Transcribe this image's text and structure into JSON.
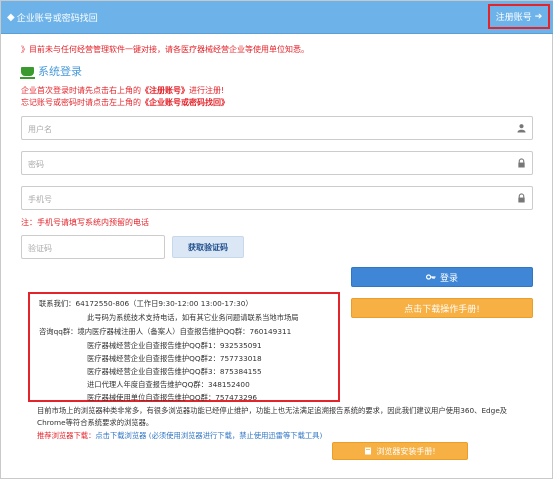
{
  "header": {
    "back_arrow": "◆",
    "back_label": "企业账号或密码找回",
    "register_label": "注册账号",
    "register_arrow": "➔"
  },
  "notice": "》目前未与任何经营管理软件一键对接，请各医疗器械经营企业等使用单位知悉。",
  "section_title": "系统登录",
  "hints": {
    "line1_prefix": "企业首次登录时请先点击右上角的",
    "line1_bold": "《注册账号》",
    "line1_suffix": "进行注册!",
    "line2_prefix": "忘记账号或密码时请点击左上角的",
    "line2_bold": "《企业账号或密码找回》"
  },
  "fields": {
    "username_placeholder": "用户名",
    "password_placeholder": "密码",
    "phone_placeholder": "手机号",
    "code_placeholder": "验证码"
  },
  "phone_note": "注：手机号请填写系统内预留的电话",
  "buttons": {
    "get_code": "获取验证码",
    "login": "登录",
    "manual": "点击下载操作手册!",
    "install": "浏览器安装手册!"
  },
  "contact": {
    "line1": "联系我们：64172550-806（工作日9:30-12:00 13:00-17:30）",
    "line2": "此号码为系统技术支持电话，如有其它业务问题请联系当地市场局",
    "line3": "咨询qq群：境内医疗器械注册人（备案人）自查报告维护QQ群：760149311",
    "line4": "医疗器械经营企业自查报告维护QQ群1：932535091",
    "line5": "医疗器械经营企业自查报告维护QQ群2：757733018",
    "line6": "医疗器械经营企业自查报告维护QQ群3：875384155",
    "line7": "进口代理人年度自查报告维护QQ群：348152400",
    "line8": "医疗器械使用单位自查报告维护QQ群：757473296"
  },
  "browser_note": "目前市场上的浏览器种类非常多，有很多浏览器功能已经停止维护，功能上也无法满足追溯报告系统的要求，因此我们建议用户使用360、Edge及Chrome等符合系统要求的浏览器。",
  "recommend": {
    "label": "推荐浏览器下载：",
    "link_text": "点击下载浏览器",
    "suffix": "(必须使用浏览器进行下载，禁止使用迅雷等下载工具)"
  },
  "colors": {
    "header_bg": "#6db3e9",
    "accent_red": "#e3242b",
    "primary_blue": "#3f87d6",
    "orange": "#f6b043"
  }
}
